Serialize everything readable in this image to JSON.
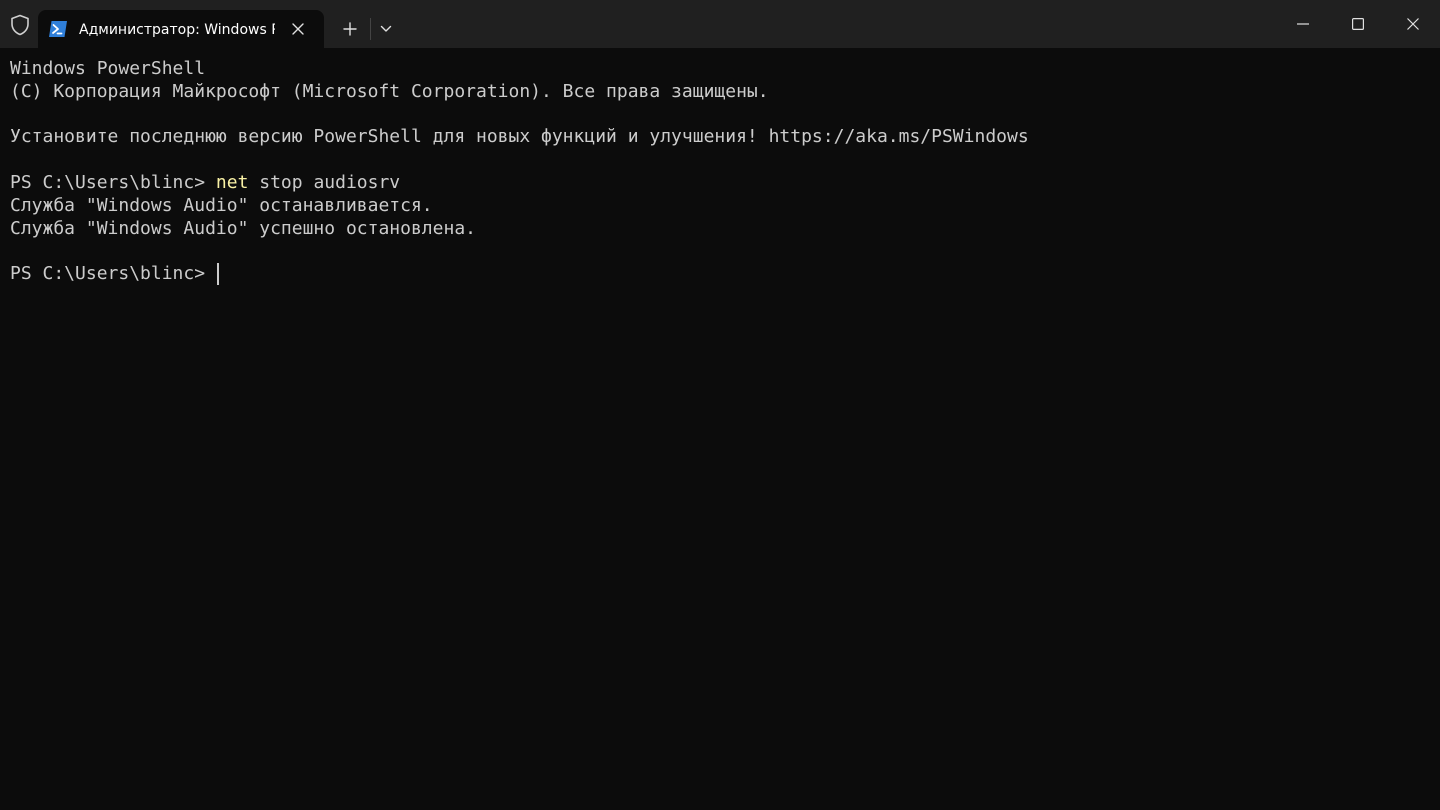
{
  "titlebar": {
    "tab_title": "Администратор: Windows Pc",
    "icons": {
      "shield": "shield-icon",
      "tab": "powershell-icon",
      "tab_close": "close-icon",
      "new_tab": "plus-icon",
      "dropdown": "chevron-down-icon",
      "minimize": "minimize-icon",
      "maximize": "maximize-icon",
      "close": "close-icon"
    }
  },
  "terminal": {
    "lines": [
      "Windows PowerShell",
      "(C) Корпорация Майкрософт (Microsoft Corporation). Все права защищены.",
      "",
      "Установите последнюю версию PowerShell для новых функций и улучшения! https://aka.ms/PSWindows",
      "",
      "",
      "Служба \"Windows Audio\" останавливается.",
      "Служба \"Windows Audio\" успешно остановлена.",
      "",
      ""
    ],
    "command_line": {
      "prompt": "PS C:\\Users\\blinc> ",
      "command": "net",
      "args": " stop audiosrv"
    },
    "current_prompt": "PS C:\\Users\\blinc> "
  },
  "colors": {
    "background": "#0c0c0c",
    "titlebar": "#202020",
    "text": "#cccccc",
    "command": "#f9f1a5"
  }
}
